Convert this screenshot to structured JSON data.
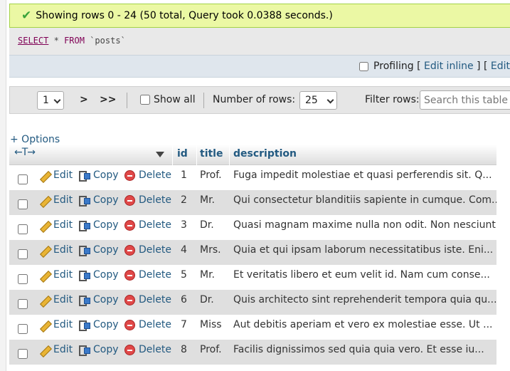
{
  "message": {
    "text": "Showing rows 0 - 24 (50 total, Query took 0.0388 seconds.)"
  },
  "sql": {
    "select": "SELECT",
    "star": "*",
    "from": "FROM",
    "table": "`posts`"
  },
  "profiling": {
    "label": "Profiling",
    "open": "[",
    "edit_inline": "Edit inline",
    "mid": "] [",
    "edit": "Edit"
  },
  "nav": {
    "page": "1",
    "next": ">",
    "last": ">>",
    "show_all": "Show all",
    "rows_label": "Number of rows:",
    "rows_value": "25",
    "filter_label": "Filter rows:",
    "search_placeholder": "Search this table"
  },
  "options_label": "+ Options",
  "table": {
    "arrows": "←T→",
    "headers": {
      "id": "id",
      "title": "title",
      "description": "description"
    },
    "actions": {
      "edit": "Edit",
      "copy": "Copy",
      "delete": "Delete"
    },
    "rows": [
      {
        "id": "1",
        "title": "Prof.",
        "description": "Fuga impedit molestiae et quasi perferendis sit. Q..."
      },
      {
        "id": "2",
        "title": "Mr.",
        "description": "Qui consectetur blanditiis sapiente in cumque. Com..."
      },
      {
        "id": "3",
        "title": "Dr.",
        "description": "Quasi magnam maxime nulla non odit. Non nesciunt e..."
      },
      {
        "id": "4",
        "title": "Mrs.",
        "description": "Quia et qui ipsam laborum necessitatibus iste. Eni..."
      },
      {
        "id": "5",
        "title": "Mr.",
        "description": "Et veritatis libero et eum velit id. Nam cum conse..."
      },
      {
        "id": "6",
        "title": "Dr.",
        "description": "Quis architecto sint reprehenderit tempora quia qu..."
      },
      {
        "id": "7",
        "title": "Miss",
        "description": "Aut debitis aperiam et vero ex molestiae esse. Ut ..."
      },
      {
        "id": "8",
        "title": "Prof.",
        "description": "Facilis dignissimos sed quia quia vero. Et esse iu..."
      }
    ]
  },
  "colors": {
    "link": "#235a81",
    "success_bg": "#ebf8a4",
    "row_alt": "#dfdfdf"
  }
}
